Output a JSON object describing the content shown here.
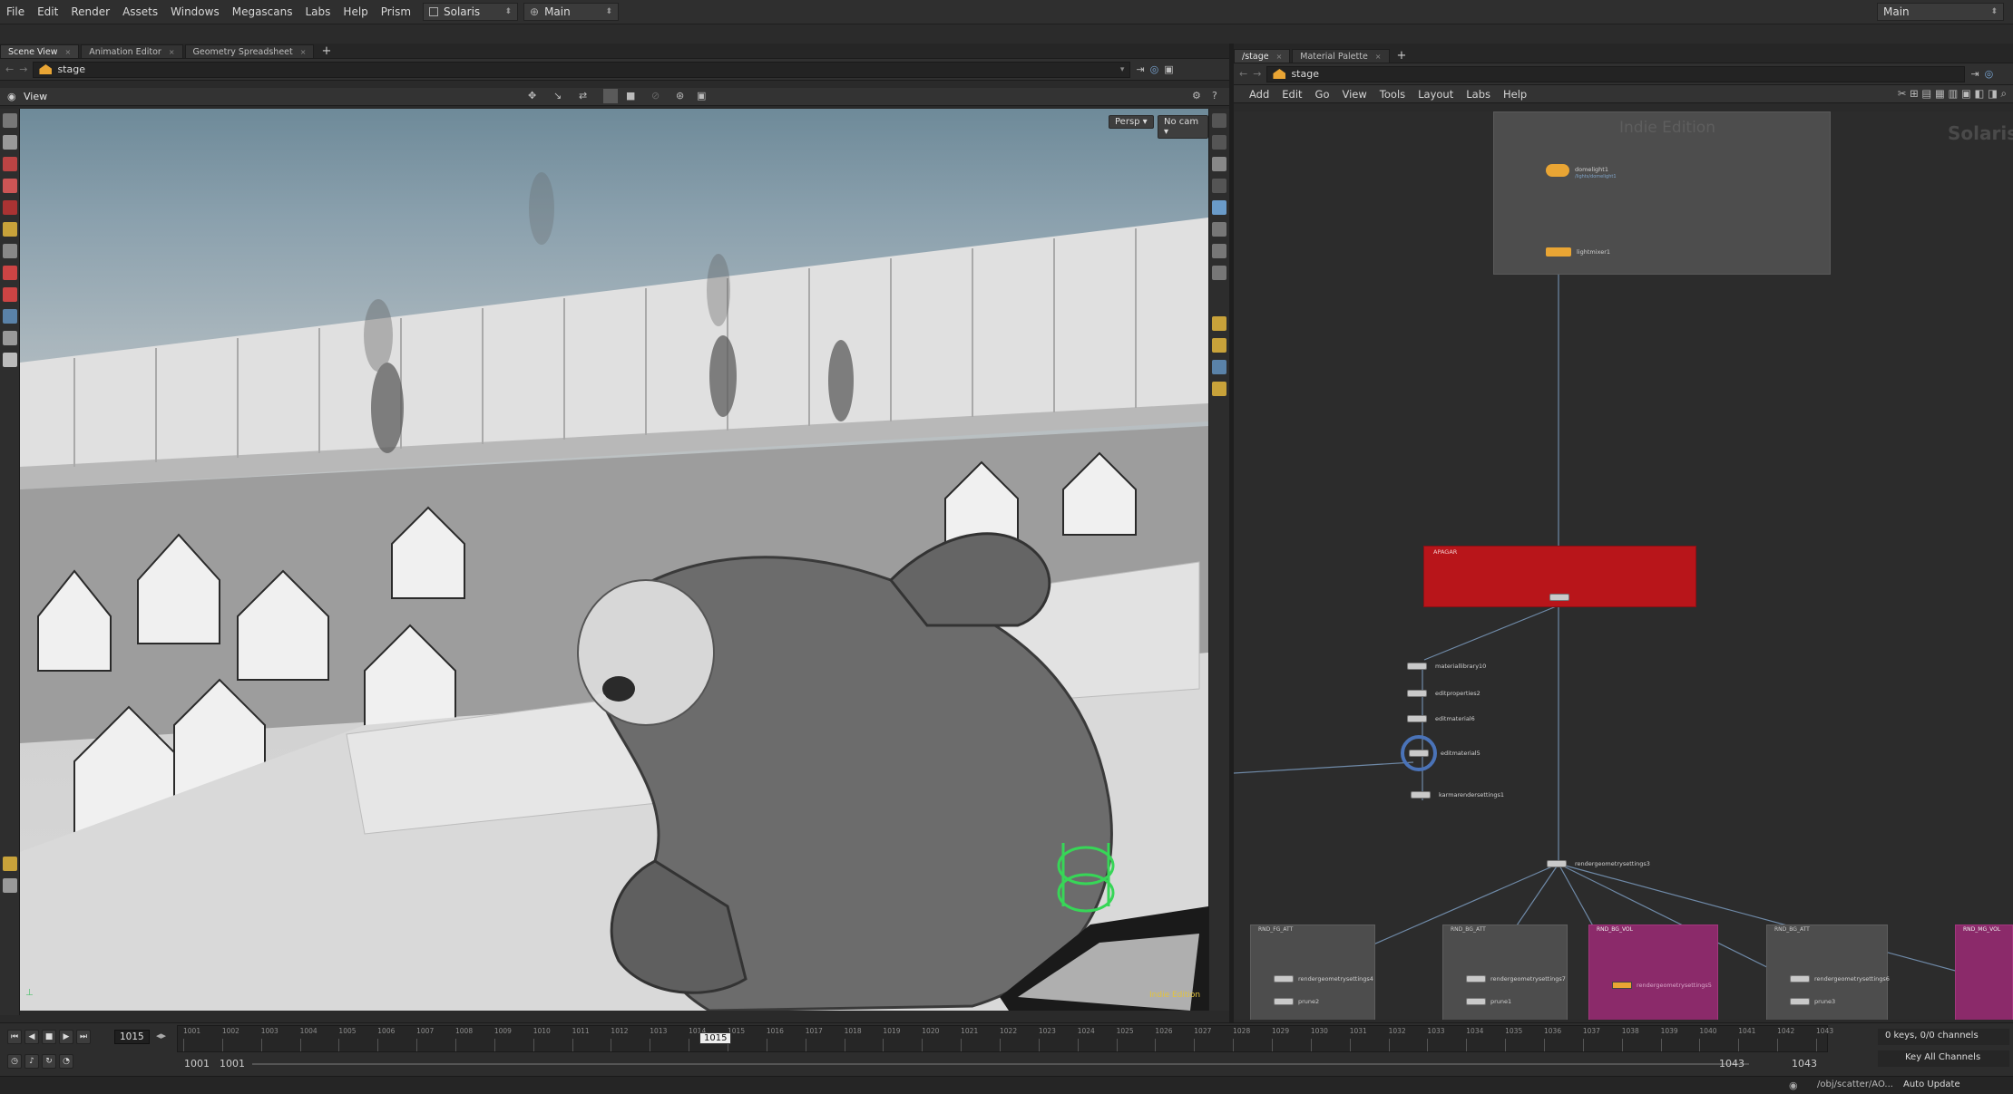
{
  "menubar": {
    "items": [
      "File",
      "Edit",
      "Render",
      "Assets",
      "Windows",
      "Megascans",
      "Labs",
      "Help",
      "Prism"
    ],
    "desktop": "Solaris",
    "context": "Main",
    "right_context": "Main"
  },
  "left_pane": {
    "tabs": [
      "Scene View",
      "Animation Editor",
      "Geometry Spreadsheet"
    ],
    "path": "stage",
    "viewer_label": "View",
    "persp_label": "Persp",
    "cam_label": "No cam",
    "watermark": "Indie Edition"
  },
  "right_pane": {
    "tabs": [
      "/stage",
      "Material Palette"
    ],
    "path": "stage",
    "menu": [
      "Add",
      "Edit",
      "Go",
      "View",
      "Tools",
      "Layout",
      "Labs",
      "Help"
    ],
    "watermark": "Indie Edition",
    "context_title": "Solaris"
  },
  "network": {
    "nodes": {
      "dome": {
        "label": "domelight1",
        "sub": "/lights/domelight1"
      },
      "light": {
        "label": "lightmixer1",
        "sub": ""
      },
      "matlib": {
        "label": "materiallibrary10",
        "sub": ""
      },
      "edit_props": {
        "label": "editproperties2",
        "sub": ""
      },
      "edit_mat1": {
        "label": "editmaterial6",
        "sub": ""
      },
      "edit_mat2": {
        "label": "editmaterial5",
        "sub": ""
      },
      "karma": {
        "label": "karmarendersettings1",
        "sub": ""
      },
      "rgs": {
        "label": "rendergeometrysettings3",
        "sub": ""
      }
    },
    "red_box_title": "APAGAR",
    "boxes": [
      "RND_FG_ATT",
      "RND_BG_ATT",
      "RND_BG_VOL",
      "RND_BG_ATT",
      "RND_MG_VOL"
    ],
    "box_nodes": [
      "rendergeometrysettings4",
      "prune2",
      "rendergeometrysettings7",
      "prune1",
      "rendergeometrysettings5",
      "rendergeometrysettings6",
      "prune3"
    ]
  },
  "timeline": {
    "current_frame": "1015",
    "ticks": [
      "1001",
      "1002",
      "1003",
      "1004",
      "1005",
      "1006",
      "1007",
      "1008",
      "1009",
      "1010",
      "1011",
      "1012",
      "1013",
      "1014",
      "1015",
      "1016",
      "1017",
      "1018",
      "1019",
      "1020",
      "1021",
      "1022",
      "1023",
      "1024",
      "1025",
      "1026",
      "1027",
      "1028",
      "1029",
      "1030",
      "1031",
      "1032",
      "1033",
      "1034",
      "1035",
      "1036",
      "1037",
      "1038",
      "1039",
      "1040",
      "1041",
      "1042",
      "1043"
    ],
    "range_start": "1001",
    "range_start2": "1001",
    "range_end": "1043",
    "range_end2": "1043",
    "keys_info": "0 keys, 0/0 channels",
    "key_all": "Key All Channels"
  },
  "statusbar": {
    "path": "/obj/scatter/AO...",
    "update_mode": "Auto Update"
  },
  "colors": {
    "accent_orange": "#e9a534",
    "node_red": "#b8151a",
    "box_magenta": "#8b2a6a",
    "network_bg": "#2c2c2c"
  }
}
